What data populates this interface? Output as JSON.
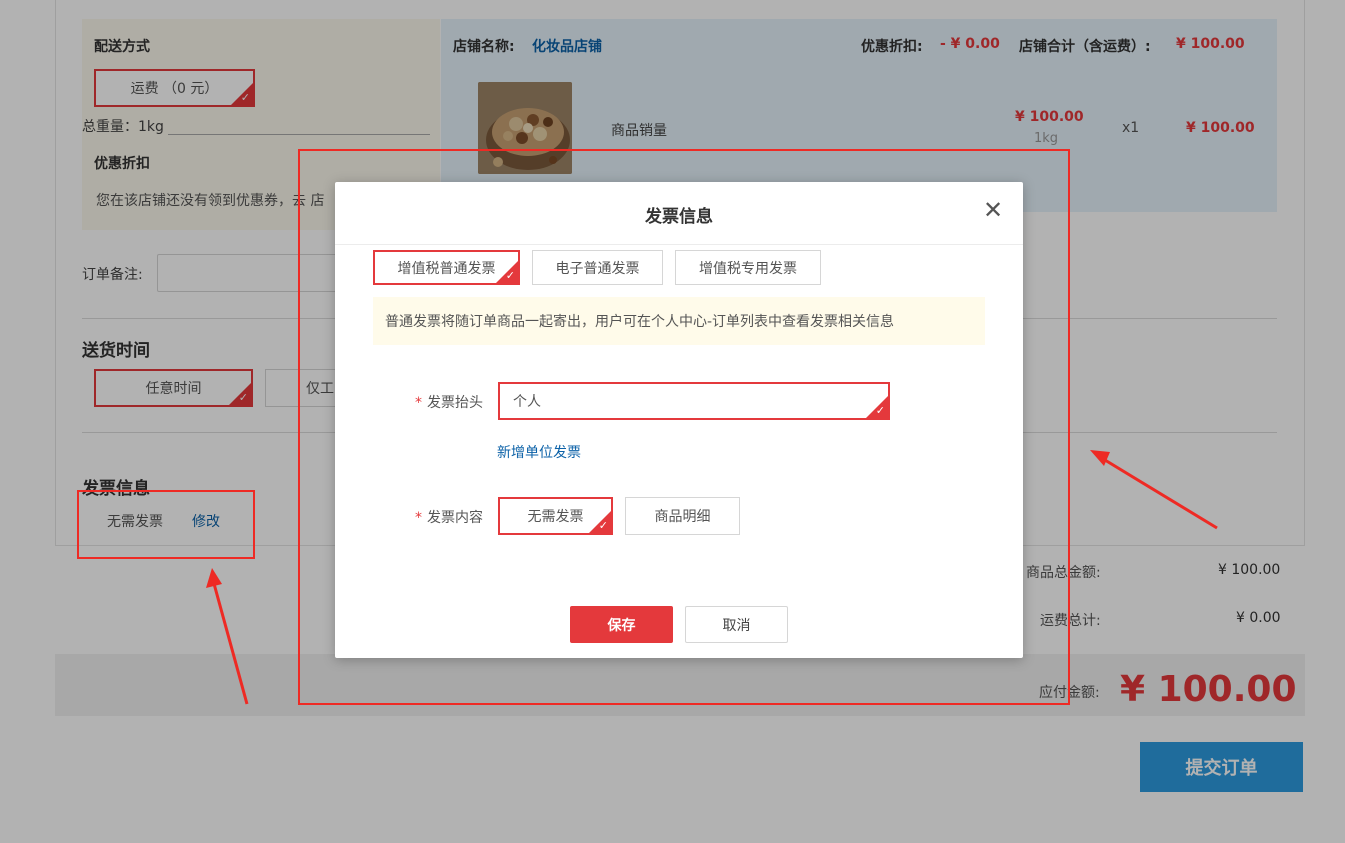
{
  "shipping": {
    "title": "配送方式",
    "option_label": "运费 （0 元）",
    "weight_label": "总重量：1kg"
  },
  "discount": {
    "title": "优惠折扣",
    "message": "您在该店铺还没有领到优惠券，去 店"
  },
  "store": {
    "name_label": "店铺名称:",
    "name": "化妆品店铺",
    "discount_label": "优惠折扣:",
    "discount_value": "- ¥ 0.00",
    "total_label": "店铺合计（含运费）:",
    "total_value": "¥ 100.00",
    "item": {
      "name": "商品销量",
      "price": "¥ 100.00",
      "weight": "1kg",
      "qty": "x1",
      "subtotal": "¥ 100.00"
    }
  },
  "order_note": {
    "label": "订单备注:"
  },
  "delivery_time": {
    "title": "送货时间",
    "options": [
      "任意时间",
      "仅工"
    ]
  },
  "invoice_section": {
    "title": "发票信息",
    "value": "无需发票",
    "edit_link": "修改"
  },
  "summary": {
    "goods_total_label": "商品总金额:",
    "goods_total_value": "¥ 100.00",
    "shipping_total_label": "运费总计:",
    "shipping_total_value": "¥ 0.00",
    "payable_label": "应付金额:",
    "payable_value": "¥ 100.00",
    "submit_label": "提交订单"
  },
  "modal": {
    "title": "发票信息",
    "close_glyph": "✕",
    "tabs": [
      "增值税普通发票",
      "电子普通发票",
      "增值税专用发票"
    ],
    "notice": "普通发票将随订单商品一起寄出，用户可在个人中心-订单列表中查看发票相关信息",
    "header_field": {
      "required_mark": "*",
      "label": "发票抬头",
      "value": "个人"
    },
    "add_company_link": "新增单位发票",
    "content_field": {
      "required_mark": "*",
      "label": "发票内容",
      "options": [
        "无需发票",
        "商品明细"
      ]
    },
    "save_label": "保存",
    "cancel_label": "取消"
  },
  "colors": {
    "accent_red": "#e4393c",
    "annotation_red": "#ee2a24",
    "link_blue": "#0c62a8",
    "submit_blue": "#2d9be0"
  }
}
